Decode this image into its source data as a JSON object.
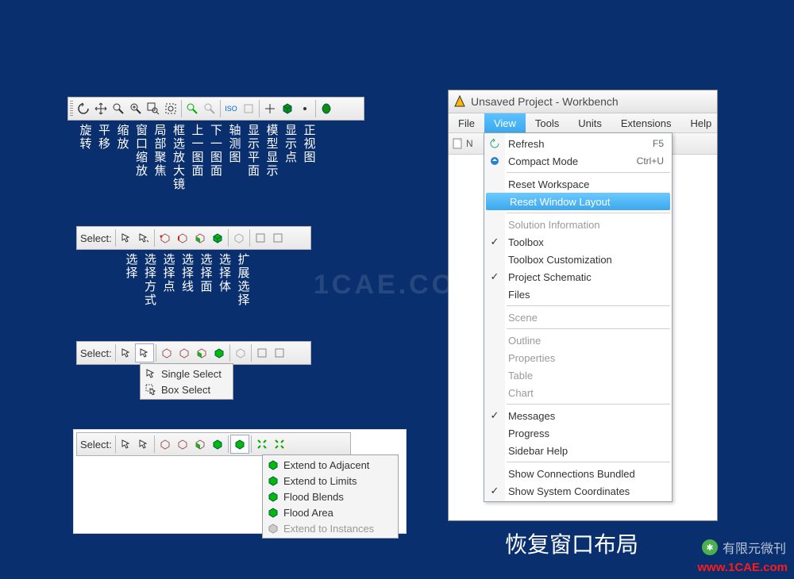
{
  "watermark": "1CAE.COM",
  "toolbar1": {
    "icons": [
      "rotate",
      "pan",
      "zoom",
      "zoom-in",
      "zoom-out",
      "zoom-window",
      "zoom-fit",
      "zoom-dim",
      "iso",
      "pick",
      "box",
      "dot",
      "leaf"
    ],
    "labels": [
      "旋转",
      "平移",
      "缩放",
      "窗口缩放",
      "局部聚焦",
      "框选放大镜",
      "上一图面",
      "下一图面",
      "轴测图",
      "显示平面",
      "模型显示",
      "显示点",
      "正视图"
    ]
  },
  "toolbar2": {
    "select_label": "Select:",
    "labels": [
      "选择",
      "选择方式",
      "选择点",
      "选择线",
      "选择面",
      "选择体",
      "扩展选择"
    ]
  },
  "toolbar3": {
    "select_label": "Select:",
    "dropdown": [
      {
        "icon": "cursor",
        "label": "Single Select"
      },
      {
        "icon": "box-cursor",
        "label": "Box Select"
      }
    ]
  },
  "toolbar4": {
    "select_label": "Select:",
    "dropdown": [
      {
        "icon": "cube-green",
        "label": "Extend to Adjacent",
        "disabled": false
      },
      {
        "icon": "cube-green",
        "label": "Extend to Limits",
        "disabled": false
      },
      {
        "icon": "cube-green",
        "label": "Flood Blends",
        "disabled": false
      },
      {
        "icon": "cube-green",
        "label": "Flood Area",
        "disabled": false
      },
      {
        "icon": "cube-grey",
        "label": "Extend to Instances",
        "disabled": true
      }
    ]
  },
  "workbench": {
    "title": "Unsaved Project - Workbench",
    "menubar": [
      "File",
      "View",
      "Tools",
      "Units",
      "Extensions",
      "Help"
    ],
    "active_menu": "View",
    "toolbar_partial": "N",
    "view_menu": [
      {
        "type": "item",
        "label": "Refresh",
        "shortcut": "F5",
        "icon": "refresh"
      },
      {
        "type": "item",
        "label": "Compact Mode",
        "shortcut": "Ctrl+U",
        "icon": "compact"
      },
      {
        "type": "sep"
      },
      {
        "type": "item",
        "label": "Reset Workspace"
      },
      {
        "type": "item",
        "label": "Reset Window Layout",
        "highlight": true
      },
      {
        "type": "sep"
      },
      {
        "type": "item",
        "label": "Solution Information",
        "disabled": true
      },
      {
        "type": "item",
        "label": "Toolbox",
        "check": true
      },
      {
        "type": "item",
        "label": "Toolbox Customization"
      },
      {
        "type": "item",
        "label": "Project Schematic",
        "check": true
      },
      {
        "type": "item",
        "label": "Files"
      },
      {
        "type": "sep"
      },
      {
        "type": "item",
        "label": "Scene",
        "disabled": true
      },
      {
        "type": "sep"
      },
      {
        "type": "item",
        "label": "Outline",
        "disabled": true
      },
      {
        "type": "item",
        "label": "Properties",
        "disabled": true
      },
      {
        "type": "item",
        "label": "Table",
        "disabled": true
      },
      {
        "type": "item",
        "label": "Chart",
        "disabled": true
      },
      {
        "type": "sep"
      },
      {
        "type": "item",
        "label": "Messages",
        "check": true
      },
      {
        "type": "item",
        "label": "Progress"
      },
      {
        "type": "item",
        "label": "Sidebar Help"
      },
      {
        "type": "sep"
      },
      {
        "type": "item",
        "label": "Show Connections Bundled"
      },
      {
        "type": "item",
        "label": "Show System Coordinates",
        "check": true
      }
    ]
  },
  "caption": "恢复窗口布局",
  "footer1": "有限元微刊",
  "footer2": "www.1CAE.com"
}
